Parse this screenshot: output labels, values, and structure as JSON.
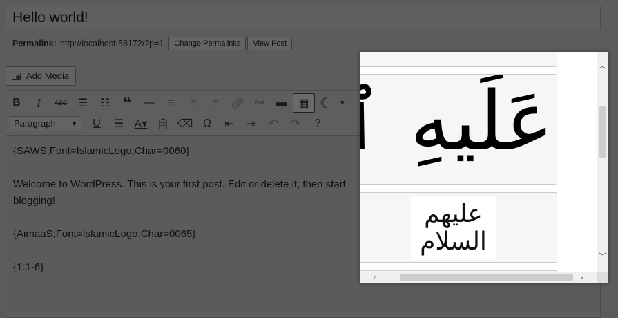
{
  "post": {
    "title": "Hello world!",
    "permalink_label": "Permalink:",
    "permalink_url": "http://localhost:58172/?p=1",
    "change_permalinks_label": "Change Permalinks",
    "view_post_label": "View Post"
  },
  "media": {
    "add_media_label": "Add Media"
  },
  "toolbar": {
    "row1_icons": [
      "bold-icon",
      "italic-icon",
      "strikethrough-icon",
      "bullet-list-icon",
      "numbered-list-icon",
      "blockquote-icon",
      "horizontal-line-icon",
      "align-left-icon",
      "align-center-icon",
      "align-right-icon",
      "link-icon",
      "unlink-icon",
      "read-more-icon",
      "toolbar-toggle-icon",
      "crescent-icon",
      "dropdown-icon"
    ],
    "row2_icons": [
      "underline-icon",
      "justify-icon",
      "text-color-icon",
      "paste-as-text-icon",
      "clear-formatting-icon",
      "special-character-icon",
      "outdent-icon",
      "indent-icon",
      "undo-icon",
      "redo-icon",
      "help-icon"
    ],
    "format_value": "Paragraph"
  },
  "content": {
    "lines": [
      "{SAWS;Font=IslamicLogo;Char=0060}",
      "Welcome to WordPress. This is your first post. Edit or delete it, then start blogging!",
      "{AimaaS;Font=IslamicLogo;Char=0065}",
      "{1:1-6}"
    ]
  },
  "popup": {
    "glyph_large": "عَلَيهِ ٱلسَّلَامُ",
    "glyph_small": "عليهم السلام",
    "scroll_up_icon": "chevron-up-icon",
    "scroll_down_icon": "chevron-down-icon",
    "scroll_left_icon": "chevron-left-icon",
    "scroll_right_icon": "chevron-right-icon"
  }
}
